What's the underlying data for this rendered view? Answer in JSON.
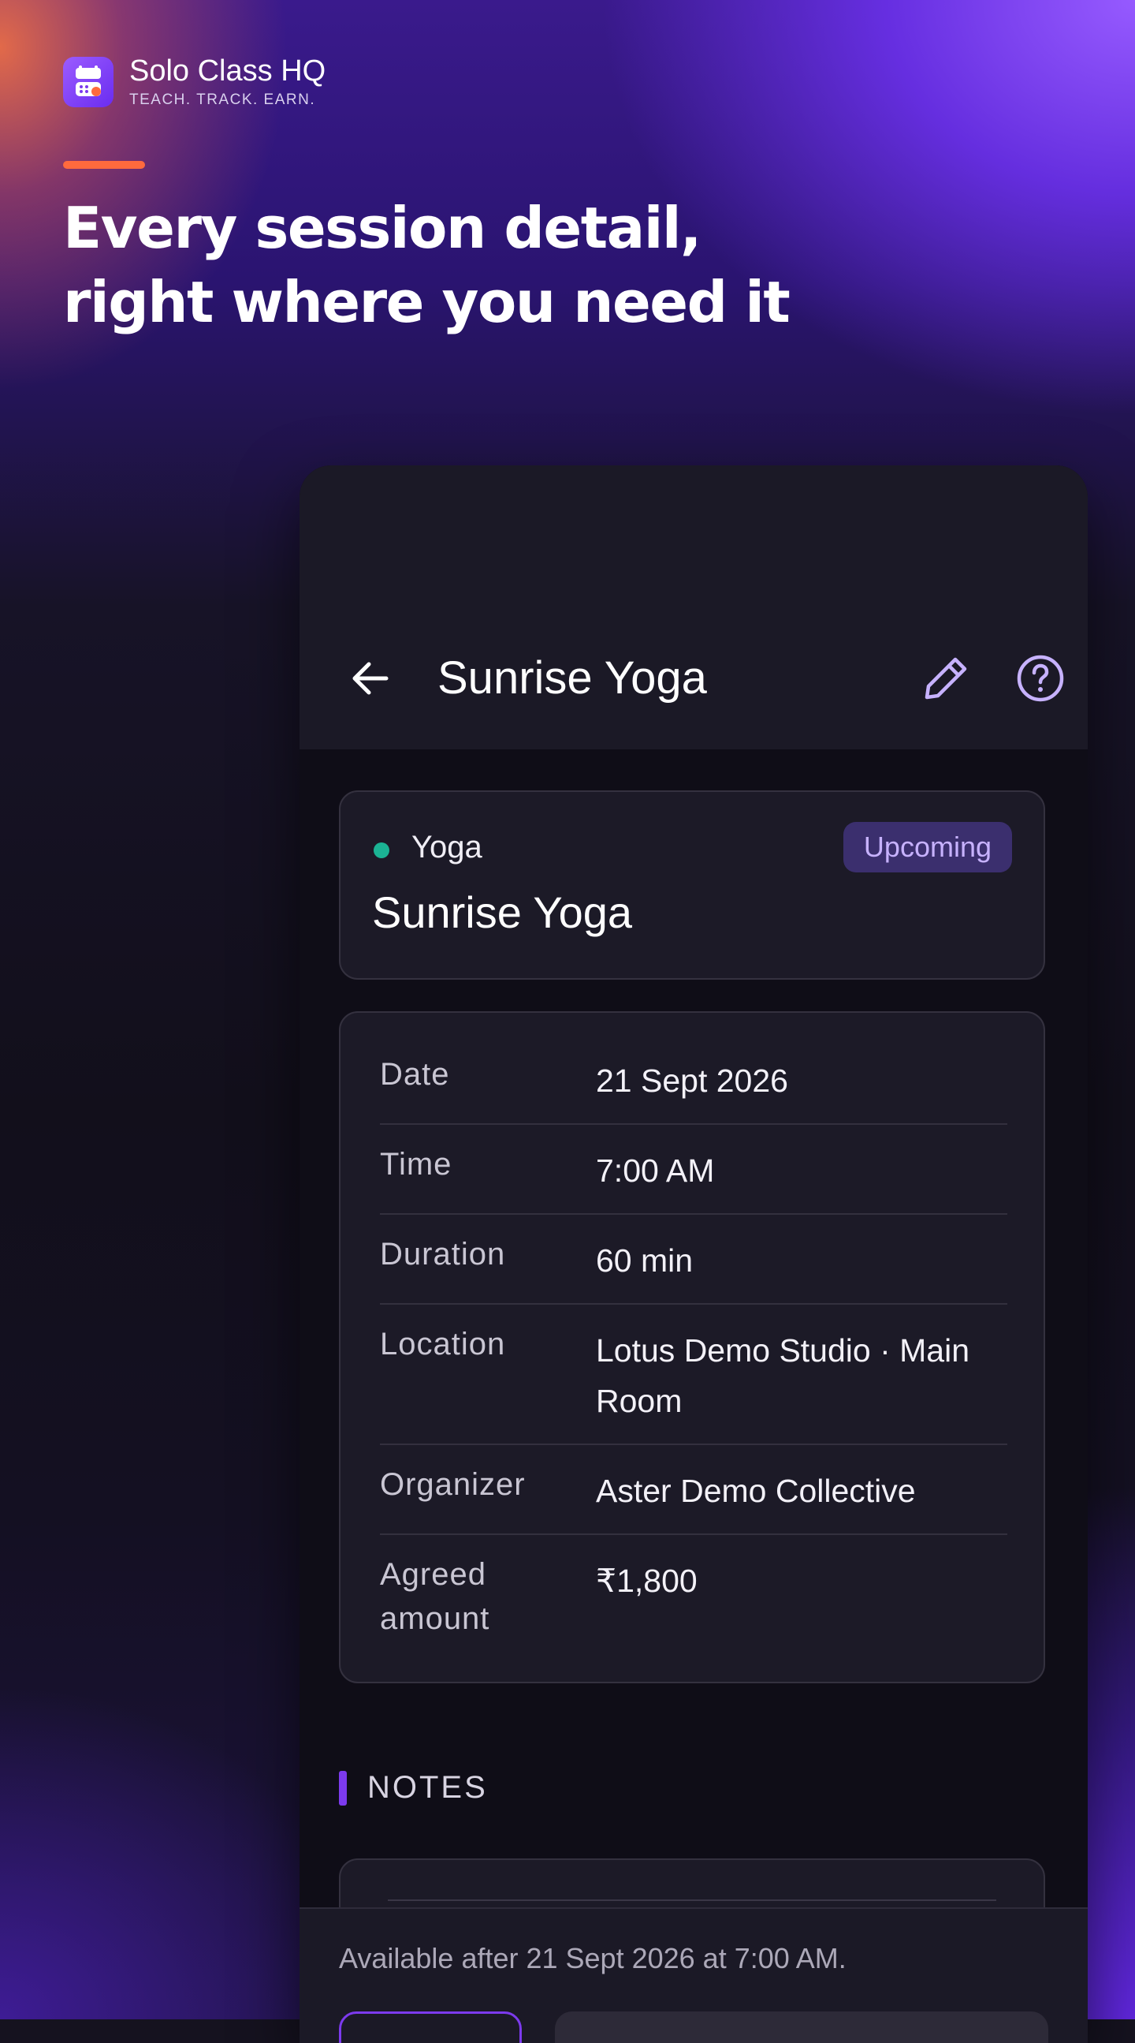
{
  "brand": {
    "name": "Solo Class HQ",
    "tagline": "TEACH. TRACK. EARN."
  },
  "headline": {
    "line1": "Every session detail,",
    "line2": "right where you need it"
  },
  "screen": {
    "title": "Sunrise Yoga",
    "icons": [
      "arrow-left-icon",
      "pencil-icon",
      "help-circle-icon"
    ]
  },
  "session": {
    "category": "Yoga",
    "status": "Upcoming",
    "title": "Sunrise Yoga"
  },
  "details": {
    "date_label": "Date",
    "date_value": "21 Sept 2026",
    "time_label": "Time",
    "time_value": "7:00 AM",
    "duration_label": "Duration",
    "duration_value": "60 min",
    "location_label": "Location",
    "location_value": "Lotus Demo Studio · Main Room",
    "organizer_label": "Organizer",
    "organizer_value": "Aster Demo Collective",
    "amount_label": "Agreed amount",
    "amount_value": "₹1,800"
  },
  "notes": {
    "heading": "NOTES"
  },
  "footer": {
    "availability": "Available after 21 Sept 2026 at 7:00 AM."
  },
  "colors": {
    "accent_orange": "#ff6a3d",
    "accent_purple": "#7c3aed",
    "category_dot": "#1bb394",
    "badge_bg": "#3b2f6e",
    "badge_text": "#c7b2ff"
  }
}
